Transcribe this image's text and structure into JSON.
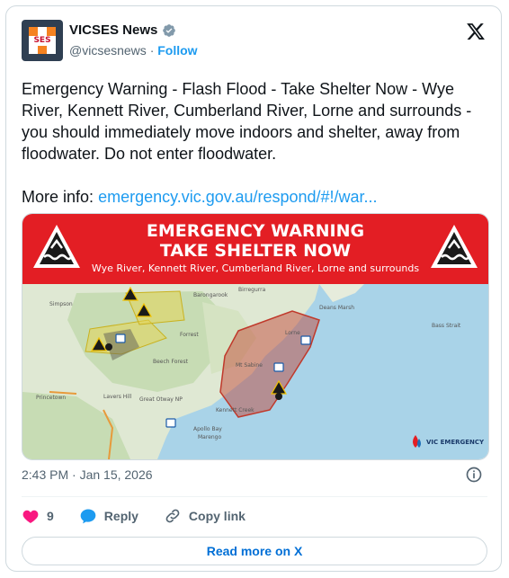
{
  "account": {
    "name": "VICSES News",
    "handle": "@vicsesnews",
    "separator": "·",
    "follow_label": "Follow",
    "avatar_text": "SES"
  },
  "tweet": {
    "text": "Emergency Warning - Flash Flood - Take Shelter Now - Wye River, Kennett River, Cumberland River, Lorne and surrounds - you should immediately move indoors and shelter, away from floodwater. Do not enter floodwater.",
    "more_info_label": "More info:",
    "link_text": "emergency.vic.gov.au/respond/#!/war..."
  },
  "media": {
    "banner_line1": "EMERGENCY WARNING",
    "banner_line2": "TAKE SHELTER NOW",
    "banner_line3": "Wye River, Kennett River, Cumberland River, Lorne and surrounds",
    "map_labels": [
      "Simpson",
      "Barongarook",
      "Birregurra",
      "Forrest",
      "Deans Marsh",
      "Lorne",
      "Apollo Bay",
      "Marengo",
      "Princetown",
      "Lavers Hill",
      "Great Otway NP",
      "Beech Forest",
      "Kennett Creek",
      "Mt Sabine",
      "Bass Strait"
    ],
    "brand": "VIC EMERGENCY"
  },
  "meta": {
    "time": "2:43 PM · Jan 15, 2026"
  },
  "actions": {
    "like_count": "9",
    "reply_label": "Reply",
    "copy_label": "Copy link"
  },
  "read_more_label": "Read more on X",
  "colors": {
    "accent": "#1d9bf0",
    "banner": "#e31e24",
    "like": "#f91880"
  }
}
